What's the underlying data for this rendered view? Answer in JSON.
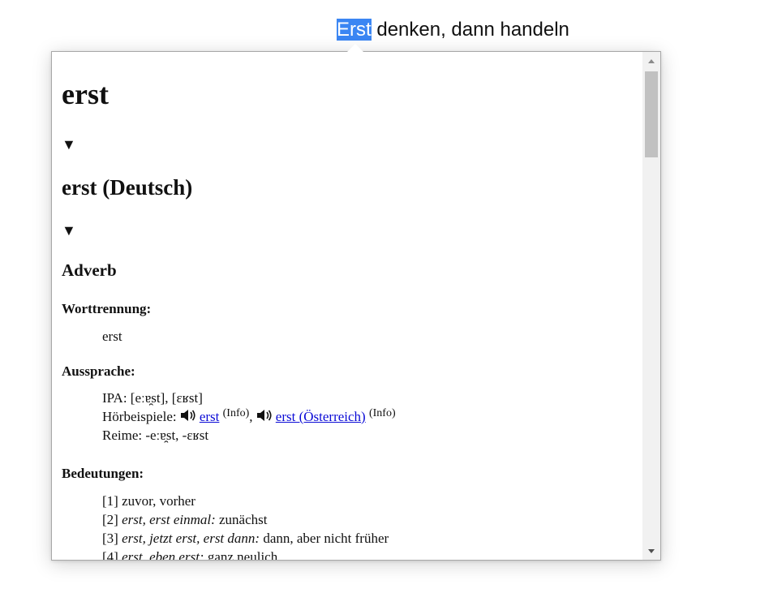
{
  "sentence": {
    "highlighted_word": "Erst",
    "rest": " denken, dann handeln"
  },
  "entry": {
    "title": "erst",
    "toggle_symbol": "▼",
    "language_heading": "erst (Deutsch)",
    "part_of_speech": "Adverb",
    "worttrennung": {
      "label": "Worttrennung:",
      "value": "erst"
    },
    "aussprache": {
      "label": "Aussprache:",
      "ipa": "IPA: [eːɐ̯st], [ɛʁst]",
      "hoerbeispiele_label": "Hörbeispiele:",
      "audio": [
        {
          "link": "erst",
          "info": "(Info)"
        },
        {
          "link": "erst (Österreich)",
          "info": "(Info)"
        }
      ],
      "separator": ",",
      "reime": "Reime: -eːɐ̯st, -ɛʁst"
    },
    "bedeutungen": {
      "label": "Bedeutungen:",
      "items": [
        {
          "num": "[1]",
          "italic": "",
          "text": " zuvor, vorher"
        },
        {
          "num": "[2]",
          "italic": "erst, erst einmal:",
          "text": " zunächst"
        },
        {
          "num": "[3]",
          "italic": "erst, jetzt erst, erst dann:",
          "text": " dann, aber nicht früher"
        },
        {
          "num": "[4]",
          "italic": "erst, eben erst:",
          "text": " ganz neulich"
        }
      ]
    }
  },
  "colors": {
    "highlight": "#3b86f3",
    "link": "#0b0bd6",
    "scroll_thumb": "#c1c1c1"
  },
  "icons": {
    "speaker": "speaker-icon",
    "scroll_up": "scroll-up-arrow-icon",
    "scroll_down": "scroll-down-arrow-icon"
  }
}
